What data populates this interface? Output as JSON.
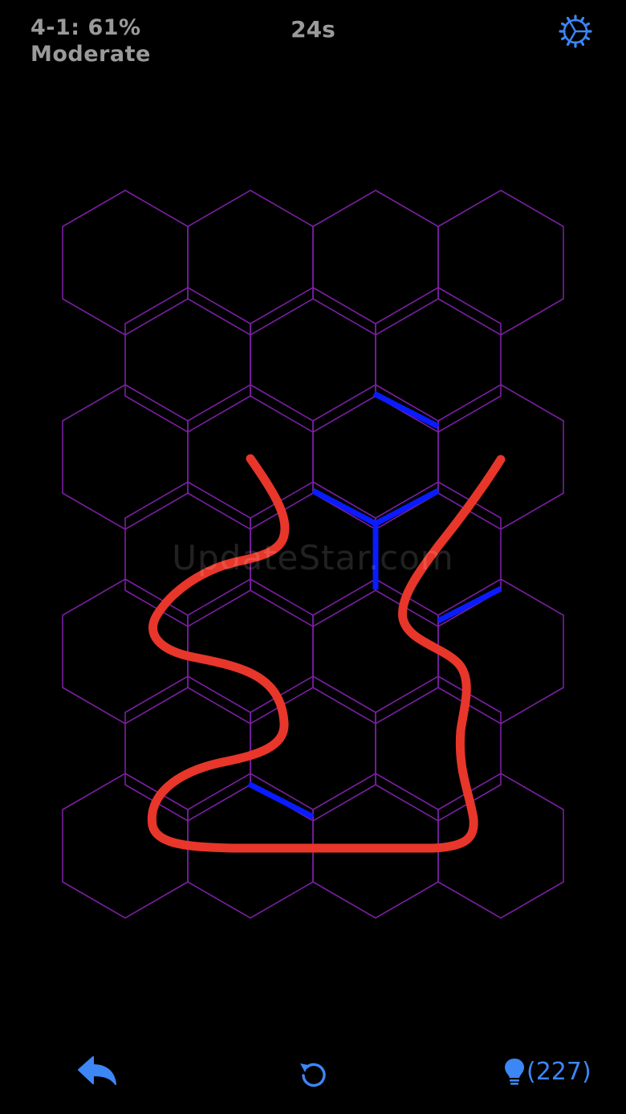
{
  "hud": {
    "level_progress": "4-1: 61%",
    "difficulty": "Moderate",
    "timer": "24s"
  },
  "watermark": "UpdateStar.com",
  "toolbar": {
    "hint_count": "(227)"
  },
  "colors": {
    "background": "#000000",
    "grid": "#7a1fa2",
    "wall": "#0a1cff",
    "path": "#e8362b",
    "accent": "#3d86f5",
    "hud_text": "#9a9a9a"
  },
  "icons": {
    "settings": "gear-icon",
    "undo": "undo-arrow-icon",
    "reset": "reset-icon",
    "hint": "lightbulb-icon"
  }
}
